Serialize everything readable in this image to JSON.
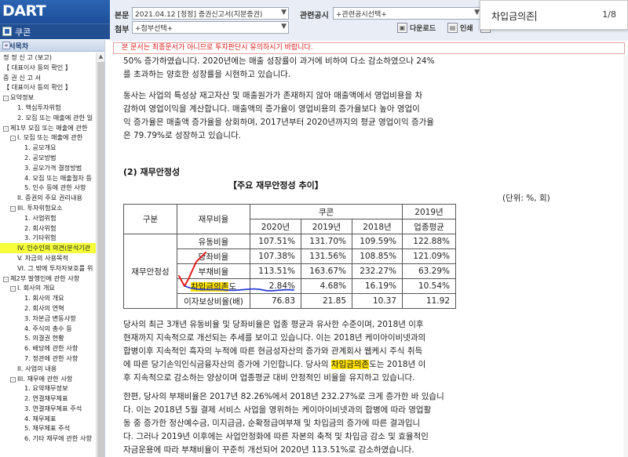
{
  "app": {
    "logo": "DART",
    "left_title": "쿠콘"
  },
  "header": {
    "main_doc_label": "본문",
    "main_doc_value": "2021.04.12 [정정] 증권신고서(지분증권)",
    "related_label": "관련공시",
    "related_value": "+관련공시선택+",
    "attach_label": "첨부",
    "attach_value": "+첨부선택+",
    "download_label": "다운로드",
    "print_label": "인쇄"
  },
  "find": {
    "query": "차입금의존",
    "count": "1/8"
  },
  "sidebar": {
    "title": "문서목차",
    "items": [
      {
        "label": "정 정 신 고 (보고)",
        "indent": 0,
        "ex": ""
      },
      {
        "label": "【 대표이사 등의 확인 】",
        "indent": 0,
        "ex": ""
      },
      {
        "label": "증 권 신 고 서",
        "indent": 0,
        "ex": ""
      },
      {
        "label": "【 대표이사 등의 확인 】",
        "indent": 0,
        "ex": ""
      },
      {
        "label": "요약정보",
        "indent": 0,
        "ex": "-"
      },
      {
        "label": "1. 핵심투자위험",
        "indent": 2,
        "ex": ""
      },
      {
        "label": "2. 모집 또는 매출에 관한 일",
        "indent": 2,
        "ex": ""
      },
      {
        "label": "제1부 모집 또는 매출에 관한",
        "indent": 0,
        "ex": "-"
      },
      {
        "label": "I. 모집 또는 매출에 관한",
        "indent": 1,
        "ex": "-"
      },
      {
        "label": "1. 공모개요",
        "indent": 3,
        "ex": ""
      },
      {
        "label": "2. 공모방법",
        "indent": 3,
        "ex": ""
      },
      {
        "label": "3. 공모가격 결정방법",
        "indent": 3,
        "ex": ""
      },
      {
        "label": "4. 모집 또는 매출절차 등",
        "indent": 3,
        "ex": ""
      },
      {
        "label": "5. 인수 등에 관한 사항",
        "indent": 3,
        "ex": ""
      },
      {
        "label": "II. 증권의 주요 권리내용",
        "indent": 2,
        "ex": ""
      },
      {
        "label": "III. 투자위험요소",
        "indent": 1,
        "ex": "-"
      },
      {
        "label": "1. 사업위험",
        "indent": 3,
        "ex": ""
      },
      {
        "label": "2. 회사위험",
        "indent": 3,
        "ex": ""
      },
      {
        "label": "3. 기타위험",
        "indent": 3,
        "ex": ""
      },
      {
        "label": "IV. 인수인의 의견(분석기관",
        "indent": 2,
        "ex": "",
        "highlight": true
      },
      {
        "label": "V. 자금의 사용목적",
        "indent": 2,
        "ex": ""
      },
      {
        "label": "VI. 그 밖에 투자자보호를 위",
        "indent": 2,
        "ex": ""
      },
      {
        "label": "제2부 발행인에 관한 사항",
        "indent": 0,
        "ex": "-"
      },
      {
        "label": "I. 회사의 개요",
        "indent": 1,
        "ex": "-"
      },
      {
        "label": "1. 회사의 개요",
        "indent": 3,
        "ex": ""
      },
      {
        "label": "2. 회사의 연혁",
        "indent": 3,
        "ex": ""
      },
      {
        "label": "3. 자본금 변동사항",
        "indent": 3,
        "ex": ""
      },
      {
        "label": "4. 주식의 총수 등",
        "indent": 3,
        "ex": ""
      },
      {
        "label": "5. 의결권 현황",
        "indent": 3,
        "ex": ""
      },
      {
        "label": "6. 배당에 관한 사항",
        "indent": 3,
        "ex": ""
      },
      {
        "label": "7. 정관에 관한 사항",
        "indent": 3,
        "ex": ""
      },
      {
        "label": "II. 사업의 내용",
        "indent": 2,
        "ex": ""
      },
      {
        "label": "III. 재무에 관한 사항",
        "indent": 1,
        "ex": "-"
      },
      {
        "label": "1. 요약재무정보",
        "indent": 3,
        "ex": ""
      },
      {
        "label": "2. 연결재무제표",
        "indent": 3,
        "ex": ""
      },
      {
        "label": "3. 연결재무제표 주석",
        "indent": 3,
        "ex": ""
      },
      {
        "label": "4. 재무제표",
        "indent": 3,
        "ex": ""
      },
      {
        "label": "5. 재무제표 주석",
        "indent": 3,
        "ex": ""
      },
      {
        "label": "6. 기타 재무에 관한 사항",
        "indent": 3,
        "ex": ""
      }
    ]
  },
  "notice": "본 문서는 최종문서가 아니므로 투자판단시 유의하시기 바랍니다.",
  "content": {
    "para1": [
      "50% 증가하였습니다. 2020년에는 매출 성장률이 과거에 비하여 다소 감소하였으나 24%",
      "를 초과하는 양호한 성장률을 시현하고 있습니다."
    ],
    "para2": [
      "동사는 사업의 특성상 재고자산 및 매출원가가 존재하지 않아 매출액에서 영업비용을 차",
      "감하여 영업이익을 계산합니다. 매출액의 증가율이 영업비용의 증가율보다 높아 영업이",
      "익 증가율은 매출액 증가율을 상회하며, 2017년부터 2020년까지의 평균 영업이익 증가율",
      "은 79.79%로 성장하고 있습니다."
    ],
    "section_title": "(2) 재무안정성",
    "table_title": "【주요 재무안정성 추이】",
    "unit": "(단위: %, 회)",
    "table": {
      "h_category": "구분",
      "h_ratio": "재무비율",
      "h_company": "쿠콘",
      "h_industry": "2019년",
      "h_industry2": "업종평균",
      "years": [
        "2020년",
        "2019년",
        "2018년"
      ],
      "group_label": "재무안정성",
      "rows": [
        {
          "name": "유동비율",
          "v": [
            "107.51%",
            "131.70%",
            "109.59%",
            "122.88%"
          ]
        },
        {
          "name": "당좌비율",
          "v": [
            "107.38%",
            "131.56%",
            "108.85%",
            "121.09%"
          ]
        },
        {
          "name": "부채비율",
          "v": [
            "113.51%",
            "163.67%",
            "232.27%",
            "63.29%"
          ]
        },
        {
          "name_hl": "차입금의존",
          "name_rest": "도",
          "v": [
            "2.84%",
            "4.68%",
            "16.19%",
            "10.54%"
          ]
        },
        {
          "name": "이자보상비율(배)",
          "v": [
            "76.83",
            "21.85",
            "10.37",
            "11.92"
          ]
        }
      ]
    },
    "para3": {
      "lines": [
        "당사의 최근 3개년 유동비율 및 당좌비율은 업종 평균과 유사한 수준이며, 2018년 이후",
        "현재까지 지속적으로 개선되는 추세를 보이고 있습니다. 이는 2018년 케이아이비넷과의",
        "합병이후 지속적인 흑자의 누적에 따른 현금성자산의 증가와 관계회사 웹케시 주식 취득",
        "에 따른 당기손익인식금융자산의 증가에 기인합니다. 당사의 "
      ],
      "hl_word": "차입금의존",
      "line4_rest": "도는 2018년 이",
      "line5": "후 지속적으로 감소하는 양상이며 업종평균 대비 안정적인 비율을 유지하고 있습니다."
    },
    "para4": [
      "한편, 당사의 부채비율은 2017년 82.26%에서 2018년 232.27%로 크게 증가한 바 있습니",
      "다. 이는 2018년 5월 결제 서비스 사업을 영위하는 케이아이비넷과의 합병에 따라 영업활",
      "동 중 증가한 정산예수금, 미지급금, 순확정급여부채 및 차입금의 증가에 따른 결과입니",
      "다. 그러나 2019년 이후에는 사업안정화에 따른 자본의 축적 및 차입금 감소 및 효율적인",
      "자금운용에 따라 부채비율이 꾸준히 개선되어 2020년 113.51%로 감소하였습니다."
    ]
  },
  "colors": {
    "brand_blue": "#1d4f98",
    "highlight_yellow": "#f6ff3a",
    "annotation_red": "#e21c1c",
    "annotation_blue": "#2a3cd6"
  }
}
